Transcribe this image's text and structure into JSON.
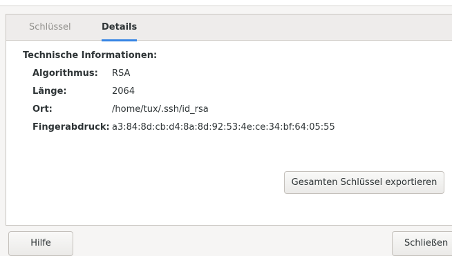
{
  "tabs": [
    {
      "label": "Schlüssel",
      "active": false
    },
    {
      "label": "Details",
      "active": true
    }
  ],
  "details": {
    "section_title": "Technische Informationen:",
    "rows": [
      {
        "label": "Algorithmus:",
        "value": "RSA"
      },
      {
        "label": "Länge:",
        "value": "2064"
      },
      {
        "label": "Ort:",
        "value": "/home/tux/.ssh/id_rsa"
      },
      {
        "label": "Fingerabdruck:",
        "value": "a3:84:8d:cb:d4:8a:8d:92:53:4e:ce:34:bf:64:05:55"
      }
    ],
    "export_button": "Gesamten Schlüssel exportieren"
  },
  "footer": {
    "help_button": "Hilfe",
    "close_button": "Schließen"
  },
  "colors": {
    "accent": "#3584e4",
    "background": "#f6f5f4",
    "panel": "#ffffff",
    "text": "#2e3436",
    "inactive_tab_text": "#92918d"
  }
}
